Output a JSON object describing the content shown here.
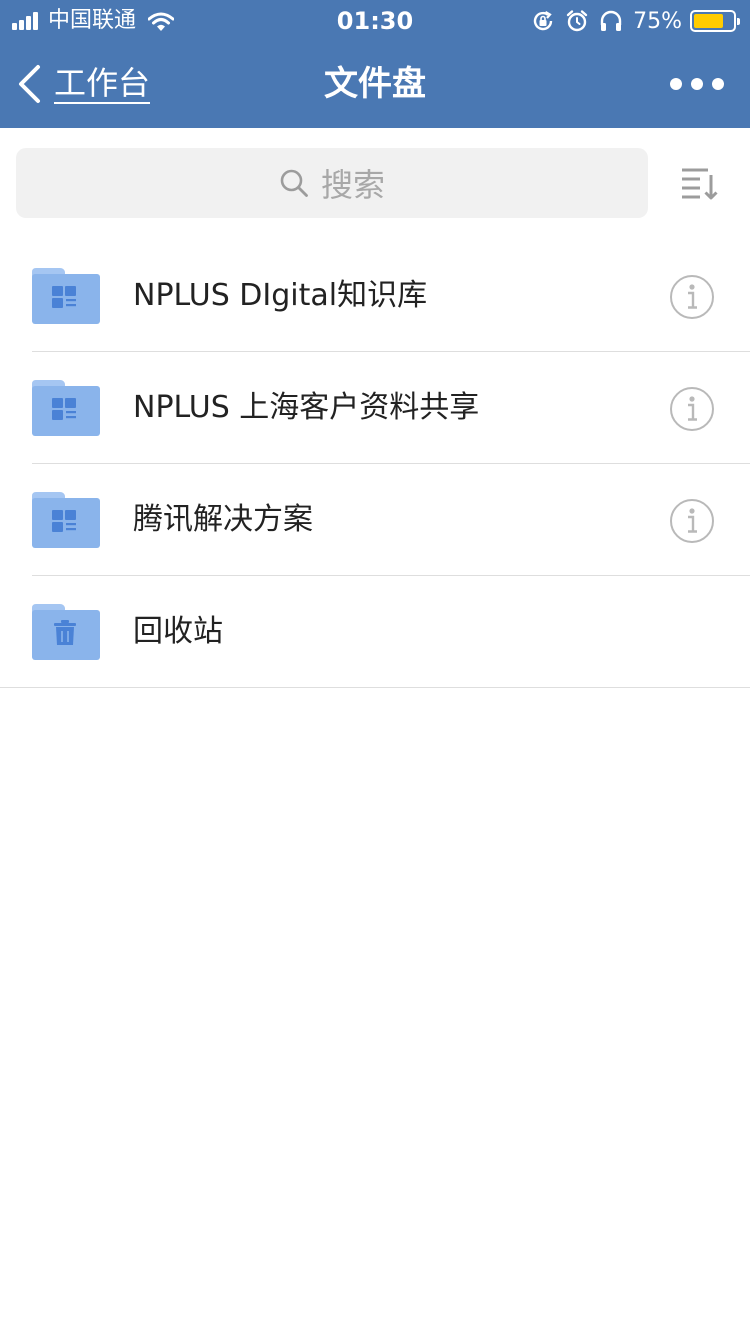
{
  "status_bar": {
    "carrier": "中国联通",
    "time": "01:30",
    "battery_percent": "75%",
    "battery_level": 0.75,
    "signal_bars": 4,
    "icons": [
      "signal-icon",
      "wifi-icon",
      "orientation-lock-icon",
      "alarm-icon",
      "headphones-icon",
      "battery-icon"
    ]
  },
  "nav": {
    "back_label": "工作台",
    "title": "文件盘",
    "more_icon": "more-dots-icon"
  },
  "search": {
    "placeholder": "搜索",
    "icon": "search-icon",
    "sort_icon": "sort-icon"
  },
  "folders": [
    {
      "name": "NPLUS DIgital知识库",
      "icon": "shared-folder-icon",
      "has_info": true
    },
    {
      "name": "NPLUS 上海客户资料共享",
      "icon": "shared-folder-icon",
      "has_info": true
    },
    {
      "name": "腾讯解决方案",
      "icon": "shared-folder-icon",
      "has_info": true
    },
    {
      "name": "回收站",
      "icon": "trash-folder-icon",
      "has_info": false
    }
  ],
  "colors": {
    "header_bg": "#4a78b3",
    "folder": "#8ab4eb",
    "folder_tab": "#a5c6f2",
    "folder_glyph": "#4a82d6",
    "battery": "#ffcc00",
    "info_icon": "#b9b9b9"
  }
}
